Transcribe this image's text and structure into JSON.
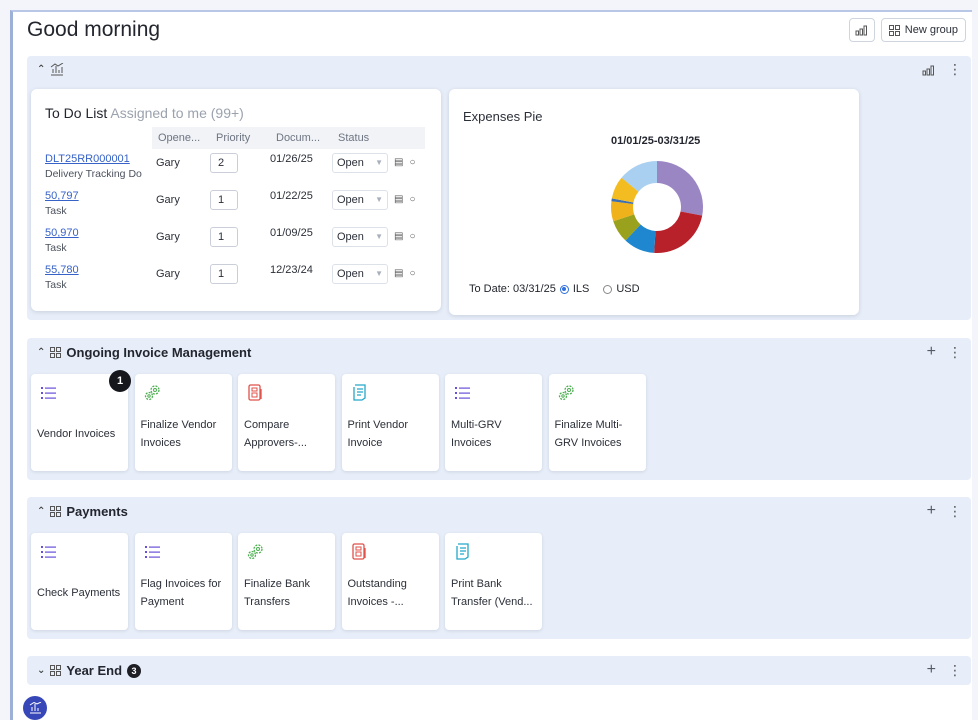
{
  "header": {
    "title": "Good morning",
    "new_group_label": "New group"
  },
  "todo": {
    "title": "To Do List",
    "subtitle": "Assigned to me (99+)",
    "columns": [
      "Opene...",
      "Priority",
      "Docum...",
      "Status"
    ],
    "rows": [
      {
        "doc": "DLT25RR000001",
        "type": "Delivery Tracking Do",
        "opened_by": "Gary",
        "priority": "2",
        "date": "01/26/25",
        "status": "Open"
      },
      {
        "doc": "50,797",
        "type": "Task",
        "opened_by": "Gary",
        "priority": "1",
        "date": "01/22/25",
        "status": "Open"
      },
      {
        "doc": "50,970",
        "type": "Task",
        "opened_by": "Gary",
        "priority": "1",
        "date": "01/09/25",
        "status": "Open"
      },
      {
        "doc": "55,780",
        "type": "Task",
        "opened_by": "Gary",
        "priority": "1",
        "date": "12/23/24",
        "status": "Open"
      }
    ]
  },
  "expenses": {
    "title": "Expenses Pie",
    "period": "01/01/25-03/31/25",
    "to_date_label": "To Date: 03/31/25",
    "currency_options": [
      "ILS",
      "USD"
    ],
    "selected_currency": "ILS"
  },
  "chart_data": {
    "type": "pie",
    "title": "01/01/25-03/31/25",
    "values": [
      28,
      23,
      11,
      8,
      7,
      1,
      8,
      14
    ],
    "colors": [
      "#9b86c4",
      "#b8202a",
      "#1f86d0",
      "#9aa11c",
      "#f0b21a",
      "#3d6fb0",
      "#f3bd22",
      "#a9d0f0"
    ]
  },
  "groups": [
    {
      "title": "Ongoing Invoice Management",
      "tiles": [
        {
          "label": "Vendor Invoices",
          "icon": "list-icon",
          "badge": "1"
        },
        {
          "label": "Finalize Vendor Invoices",
          "icon": "gears-icon"
        },
        {
          "label": "Compare Approvers-...",
          "icon": "document-calc-icon"
        },
        {
          "label": "Print Vendor Invoice",
          "icon": "print-doc-icon"
        },
        {
          "label": "Multi-GRV Invoices",
          "icon": "list-icon"
        },
        {
          "label": "Finalize Multi-GRV Invoices",
          "icon": "gears-icon"
        }
      ]
    },
    {
      "title": "Payments",
      "tiles": [
        {
          "label": "Check Payments",
          "icon": "list-icon"
        },
        {
          "label": "Flag Invoices for Payment",
          "icon": "list-icon"
        },
        {
          "label": "Finalize Bank Transfers",
          "icon": "gears-icon"
        },
        {
          "label": "Outstanding Invoices -...",
          "icon": "document-calc-icon"
        },
        {
          "label": "Print Bank Transfer (Vend...",
          "icon": "print-doc-icon"
        }
      ]
    },
    {
      "title": "Year End",
      "count": "3"
    }
  ],
  "colors": {
    "accent": "#3762c8",
    "group_bg": "#e7eef9",
    "list_icon": "#6a4fd8",
    "gears_icon": "#4caf50",
    "calc_icon": "#e0524a",
    "print_icon": "#25a8c9"
  }
}
